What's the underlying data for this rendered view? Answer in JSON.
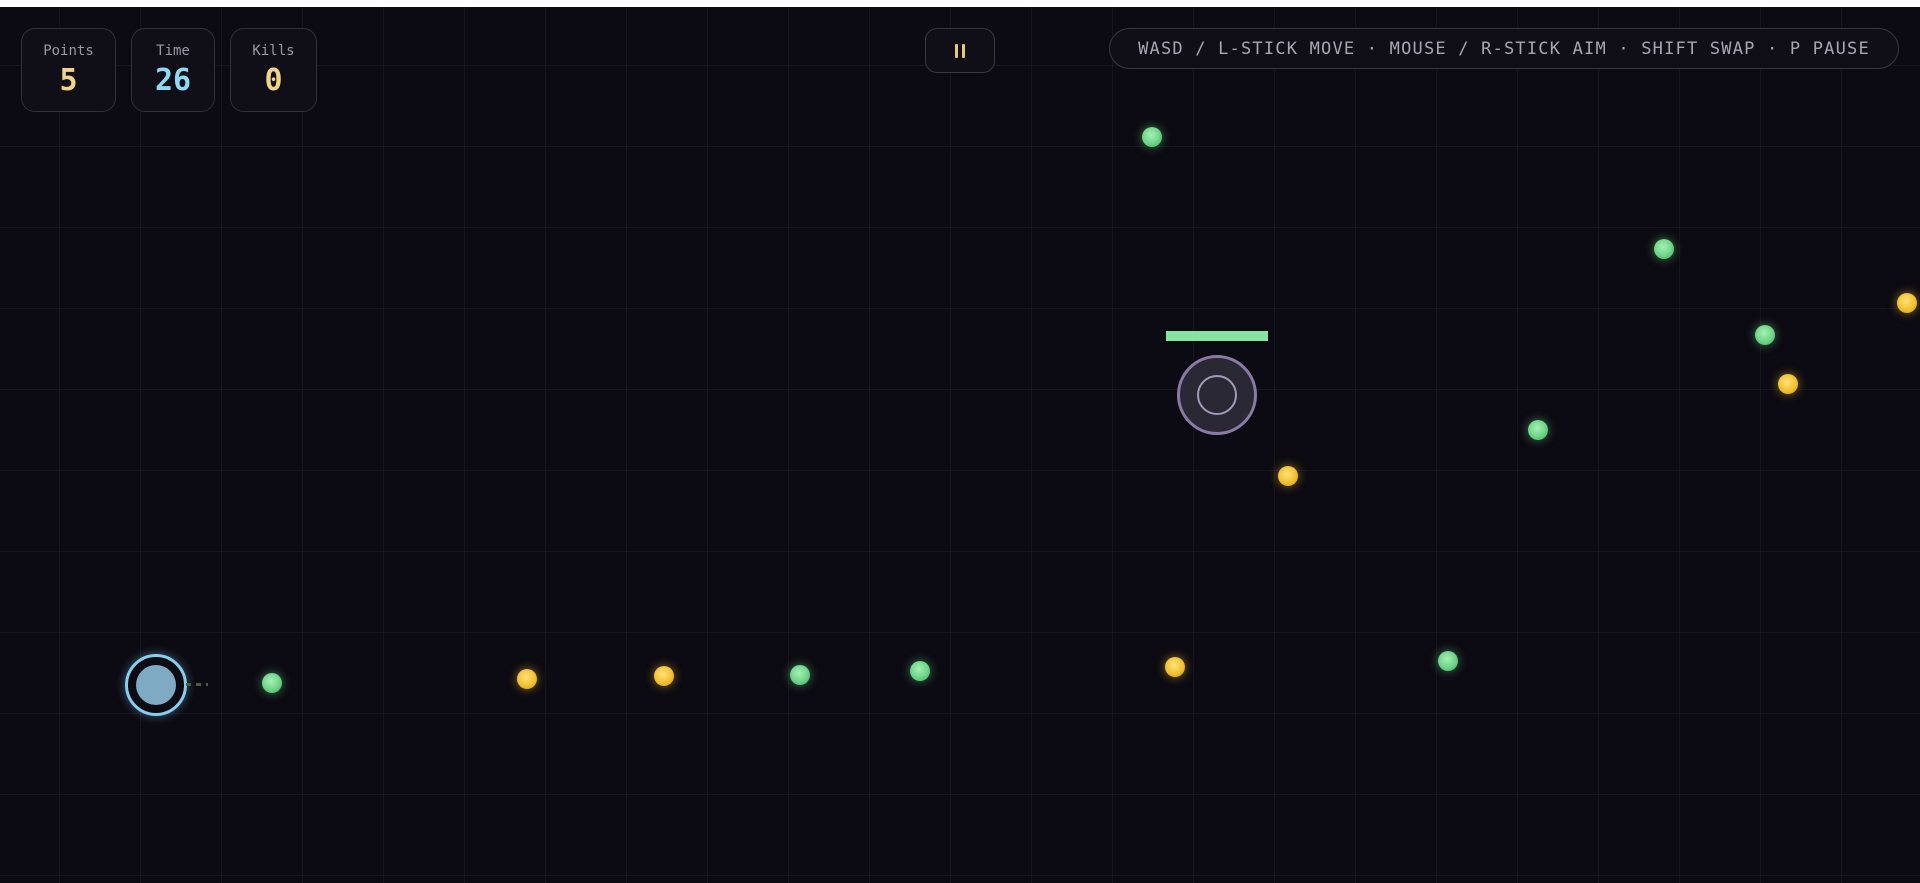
{
  "hud": {
    "points": {
      "label": "Points",
      "value": "5",
      "color": "#f0d48a"
    },
    "time": {
      "label": "Time",
      "value": "26",
      "color": "#8fd9f4"
    },
    "kills": {
      "label": "Kills",
      "value": "0",
      "color": "#f0d48a"
    }
  },
  "pause_button": {
    "icon": "pause-icon",
    "color": "#e8c77a"
  },
  "controls_hint": "WASD / L-STICK MOVE · MOUSE / R-STICK AIM · SHIFT SWAP · P PAUSE",
  "enemy": {
    "health_fraction": 1.0,
    "health_color": "#86e4a0"
  },
  "colors": {
    "background": "#0c0a12",
    "player": "#86cfee",
    "green_orb": "#6cd486",
    "gold_orb": "#f2c030",
    "enemy": "#8a7aa4"
  }
}
